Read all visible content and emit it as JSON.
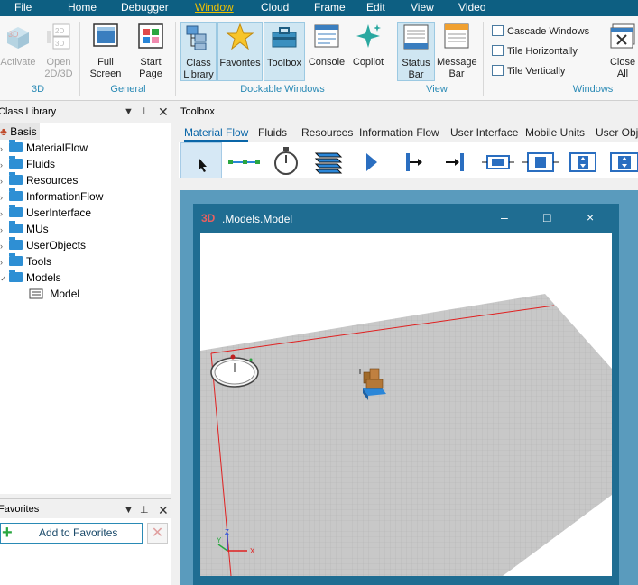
{
  "menubar": {
    "items": [
      "File",
      "Home",
      "Debugger",
      "Window",
      "Cloud",
      "Frame",
      "Edit",
      "View",
      "Video"
    ],
    "active": "Window"
  },
  "ribbon": {
    "groups": {
      "g3d": {
        "label": "3D",
        "buttons": [
          {
            "label": "Activate"
          },
          {
            "label": "Open\n2D/3D"
          }
        ]
      },
      "general": {
        "label": "General",
        "buttons": [
          {
            "label": "Full\nScreen"
          },
          {
            "label": "Start\nPage"
          }
        ]
      },
      "dockable": {
        "label": "Dockable Windows",
        "buttons": [
          {
            "label": "Class\nLibrary"
          },
          {
            "label": "Favorites"
          },
          {
            "label": "Toolbox"
          },
          {
            "label": "Console"
          },
          {
            "label": "Copilot"
          }
        ]
      },
      "view": {
        "label": "View",
        "buttons": [
          {
            "label": "Status\nBar"
          },
          {
            "label": "Message\nBar"
          }
        ]
      },
      "windows": {
        "label": "Windows",
        "small": [
          "Cascade Windows",
          "Tile Horizontally",
          "Tile Vertically"
        ],
        "close_all": "Close\nAll"
      }
    }
  },
  "class_library": {
    "title": "Class Library",
    "root": "Basis",
    "items": [
      "MaterialFlow",
      "Fluids",
      "Resources",
      "InformationFlow",
      "UserInterface",
      "MUs",
      "UserObjects",
      "Tools",
      "Models"
    ],
    "child": "Model"
  },
  "favorites": {
    "title": "Favorites",
    "add_label": "Add to Favorites"
  },
  "toolbox": {
    "title": "Toolbox",
    "tabs": [
      "Material Flow",
      "Fluids",
      "Resources",
      "Information Flow",
      "User Interface",
      "Mobile Units",
      "User Obje"
    ],
    "active_tab": "Material Flow"
  },
  "model_window": {
    "badge": "3D",
    "title": ".Models.Model",
    "minimize": "–",
    "maximize": "□",
    "close": "×"
  },
  "colors": {
    "menubar": "#0d5f82",
    "accent": "#2a8ab5",
    "workspace": "#5a9bbd",
    "mdi": "#1f6d92"
  }
}
